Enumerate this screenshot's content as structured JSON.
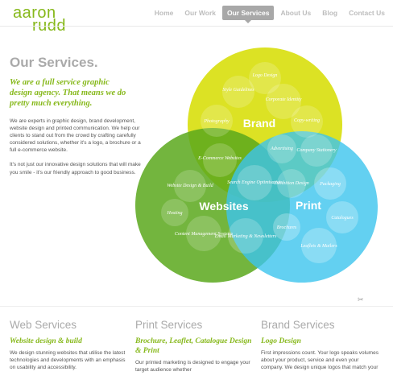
{
  "logo": {
    "line1": "aaron",
    "line2": "rudd"
  },
  "nav": [
    {
      "label": "Home",
      "active": false
    },
    {
      "label": "Our Work",
      "active": false
    },
    {
      "label": "Our Services",
      "active": true
    },
    {
      "label": "About Us",
      "active": false
    },
    {
      "label": "Blog",
      "active": false
    },
    {
      "label": "Contact Us",
      "active": false
    }
  ],
  "page_title": "Our Services.",
  "tagline": "We are a full service graphic design agency. That means we do pretty much everything.",
  "intro": [
    "We are experts in graphic design, brand development, website design and printed communication. We help our clients to stand out from the crowd by crafting carefully considered solutions, whether it's a logo, a brochure or a full e-commerce website.",
    "It's not just our innovative design solutions that will make you smile - it's our friendly approach to good business."
  ],
  "diagram": {
    "colors": {
      "brand": "#d8df0c",
      "websites": "#5ba81c",
      "print": "#3cc4ee"
    },
    "brand": {
      "label": "Brand",
      "items": [
        "Logo Design",
        "Style Guidelines",
        "Corporate Identity",
        "Photography",
        "Copy-writing"
      ]
    },
    "websites": {
      "label": "Websites",
      "items": [
        "E-Commerce Websites",
        "Website Design & Build",
        "Hosting",
        "Content Management Systems"
      ]
    },
    "print": {
      "label": "Print",
      "items": [
        "Packaging",
        "Catalogues",
        "Brochures",
        "Leaflets & Mailers"
      ]
    },
    "overlap": [
      "Advertising",
      "Company Stationery",
      "Search Engine Optimisation",
      "Exhibition Design",
      "Email Marketing & Newsletters"
    ]
  },
  "columns": [
    {
      "title": "Web Services",
      "subtitle": "Website design & build",
      "body": "We design stunning websites that utilise the latest technologies and developments with an emphasis on usability and accessibility."
    },
    {
      "title": "Print Services",
      "subtitle": "Brochure, Leaflet, Catalogue Design & Print",
      "body": "Our printed marketing is designed to engage your target audience whether"
    },
    {
      "title": "Brand Services",
      "subtitle": "Logo Design",
      "body": "First impressions count. Your logo speaks volumes about your product, service and even your company. We design unique logos that match your"
    }
  ]
}
